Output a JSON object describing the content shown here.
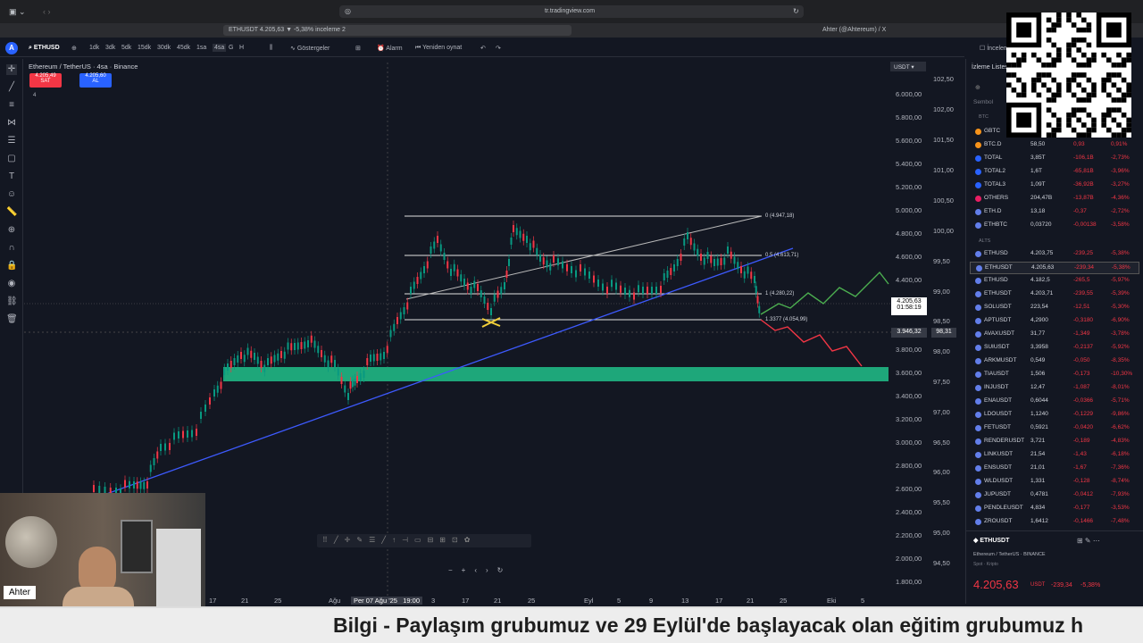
{
  "browser": {
    "url": "tr.tradingview.com",
    "tab_left": "ETHUSDT 4.205,63 ▼ -5,38% inceleme 2",
    "tab_right": "Ahter (@Ahtereum) / X"
  },
  "toolbar": {
    "symbol": "ETHUSD",
    "intervals": [
      "1dk",
      "3dk",
      "5dk",
      "15dk",
      "30dk",
      "45dk",
      "1sa",
      "4sa",
      "G",
      "H"
    ],
    "indicators": "Göstergeler",
    "alarm": "Alarm",
    "replay": "Yeniden oynat",
    "right_label": "İnceleme"
  },
  "chart": {
    "title": "Ethereum / TetherUS · 4sa · Binance",
    "sell_price": "4.205,49",
    "sell_label": "SAT",
    "buy_price": "4.205,60",
    "buy_label": "AL",
    "counter": "4",
    "currency": "USDT",
    "current_price": "4.205,63",
    "countdown": "01:58:19",
    "cross_price": "3.946,32",
    "cross_ratio": "98,31",
    "fib_levels": [
      {
        "label": "0 (4.947,18)"
      },
      {
        "label": "0.5 (4.613,71)"
      },
      {
        "label": "1 (4.280,22)"
      },
      {
        "label": "1.3377 (4.054,99)"
      }
    ],
    "price_axis": [
      "6.000,00",
      "5.800,00",
      "5.600,00",
      "5.400,00",
      "5.200,00",
      "5.000,00",
      "4.800,00",
      "4.600,00",
      "4.400,00",
      "3.800,00",
      "3.600,00",
      "3.400,00",
      "3.200,00",
      "3.000,00",
      "2.800,00",
      "2.600,00",
      "2.400,00",
      "2.200,00",
      "2.000,00",
      "1.800,00"
    ],
    "ratio_axis": [
      "102,50",
      "102,00",
      "101,50",
      "101,00",
      "100,50",
      "100,00",
      "99,50",
      "99,00",
      "98,50",
      "98,00",
      "97,50",
      "97,00",
      "96,50",
      "96,00",
      "95,50",
      "95,00",
      "94,50"
    ],
    "date_axis": [
      "17",
      "21",
      "25",
      "Ağu",
      "Per 07 Ağu '25   19:00",
      "3",
      "17",
      "21",
      "25",
      "Eyl",
      "5",
      "9",
      "13",
      "17",
      "21",
      "25",
      "Eki",
      "5"
    ]
  },
  "watchlist": {
    "title": "İzleme Listesi",
    "symbol_header": "Sembol",
    "section_btc": "BTC",
    "section_alts": "ALTS",
    "rows": [
      {
        "sym": "GBTC",
        "last": "",
        "chg": "",
        "pct": "",
        "color": "#b2b5be"
      },
      {
        "sym": "BTC.D",
        "last": "58,50",
        "chg": "0,93",
        "pct": "0,91%",
        "color": "#f23645"
      },
      {
        "sym": "TOTAL",
        "last": "3,85T",
        "chg": "-106,1B",
        "pct": "-2,73%",
        "color": "#f23645"
      },
      {
        "sym": "TOTAL2",
        "last": "1,6T",
        "chg": "-65,81B",
        "pct": "-3,96%",
        "color": "#f23645"
      },
      {
        "sym": "TOTAL3",
        "last": "1,09T",
        "chg": "-36,92B",
        "pct": "-3,27%",
        "color": "#f23645"
      },
      {
        "sym": "OTHERS",
        "last": "204,47B",
        "chg": "-13,87B",
        "pct": "-4,36%",
        "color": "#f23645"
      },
      {
        "sym": "ETH.D",
        "last": "13,18",
        "chg": "-0,37",
        "pct": "-2,72%",
        "color": "#f23645"
      },
      {
        "sym": "ETHBTC",
        "last": "0,03720",
        "chg": "-0,00138",
        "pct": "-3,58%",
        "color": "#f23645"
      },
      {
        "sym": "ETHUSD",
        "last": "4.203,75",
        "chg": "-239,25",
        "pct": "-5,38%",
        "color": "#f23645"
      },
      {
        "sym": "ETHUSDT",
        "last": "4.205,63",
        "chg": "-239,34",
        "pct": "-5,38%",
        "color": "#f23645"
      },
      {
        "sym": "ETHUSD",
        "last": "4.182,5",
        "chg": "-265,5",
        "pct": "-5,97%",
        "color": "#f23645"
      },
      {
        "sym": "ETHUSDT",
        "last": "4.203,71",
        "chg": "-239,55",
        "pct": "-5,39%",
        "color": "#f23645"
      },
      {
        "sym": "SOLUSDT",
        "last": "223,54",
        "chg": "-12,51",
        "pct": "-5,30%",
        "color": "#f23645"
      },
      {
        "sym": "APTUSDT",
        "last": "4,2900",
        "chg": "-0,3180",
        "pct": "-6,90%",
        "color": "#f23645"
      },
      {
        "sym": "AVAXUSDT",
        "last": "31,77",
        "chg": "-1,349",
        "pct": "-3,78%",
        "color": "#f23645"
      },
      {
        "sym": "SUIUSDT",
        "last": "3,3958",
        "chg": "-0,2137",
        "pct": "-5,92%",
        "color": "#f23645"
      },
      {
        "sym": "ARKMUSDT",
        "last": "0,549",
        "chg": "-0,050",
        "pct": "-8,35%",
        "color": "#f23645"
      },
      {
        "sym": "TIAUSDT",
        "last": "1,506",
        "chg": "-0,173",
        "pct": "-10,30%",
        "color": "#f23645"
      },
      {
        "sym": "INJUSDT",
        "last": "12,47",
        "chg": "-1,087",
        "pct": "-8,01%",
        "color": "#f23645"
      },
      {
        "sym": "ENAUSDT",
        "last": "0,6044",
        "chg": "-0,0366",
        "pct": "-5,71%",
        "color": "#f23645"
      },
      {
        "sym": "LDOUSDT",
        "last": "1,1240",
        "chg": "-0,1229",
        "pct": "-9,86%",
        "color": "#f23645"
      },
      {
        "sym": "FETUSDT",
        "last": "0,5921",
        "chg": "-0,0420",
        "pct": "-6,62%",
        "color": "#f23645"
      },
      {
        "sym": "RENDERUSDT",
        "last": "3,721",
        "chg": "-0,189",
        "pct": "-4,83%",
        "color": "#f23645"
      },
      {
        "sym": "LINKUSDT",
        "last": "21,54",
        "chg": "-1,43",
        "pct": "-6,18%",
        "color": "#f23645"
      },
      {
        "sym": "ENSUSDT",
        "last": "21,01",
        "chg": "-1,67",
        "pct": "-7,36%",
        "color": "#f23645"
      },
      {
        "sym": "WLDUSDT",
        "last": "1,331",
        "chg": "-0,128",
        "pct": "-8,74%",
        "color": "#f23645"
      },
      {
        "sym": "JUPUSDT",
        "last": "0,4781",
        "chg": "-0,0412",
        "pct": "-7,93%",
        "color": "#f23645"
      },
      {
        "sym": "PENDLEUSDT",
        "last": "4,834",
        "chg": "-0,177",
        "pct": "-3,53%",
        "color": "#f23645"
      },
      {
        "sym": "ZROUSDT",
        "last": "1,6412",
        "chg": "-0,1466",
        "pct": "-7,48%",
        "color": "#f23645"
      }
    ]
  },
  "details": {
    "symbol": "ETHUSDT",
    "name": "Ethereum / TetherUS · BINANCE",
    "sub": "Spot · Kripto",
    "price": "4.205,63",
    "currency": "USDT",
    "change": "-239,34",
    "pct": "-5,38%"
  },
  "webcam": {
    "name": "Ahter"
  },
  "banner": {
    "text": "Bilgi - Paylaşım grubumuz ve 29 Eylül'de başlayacak olan eğitim grubumuz h"
  }
}
